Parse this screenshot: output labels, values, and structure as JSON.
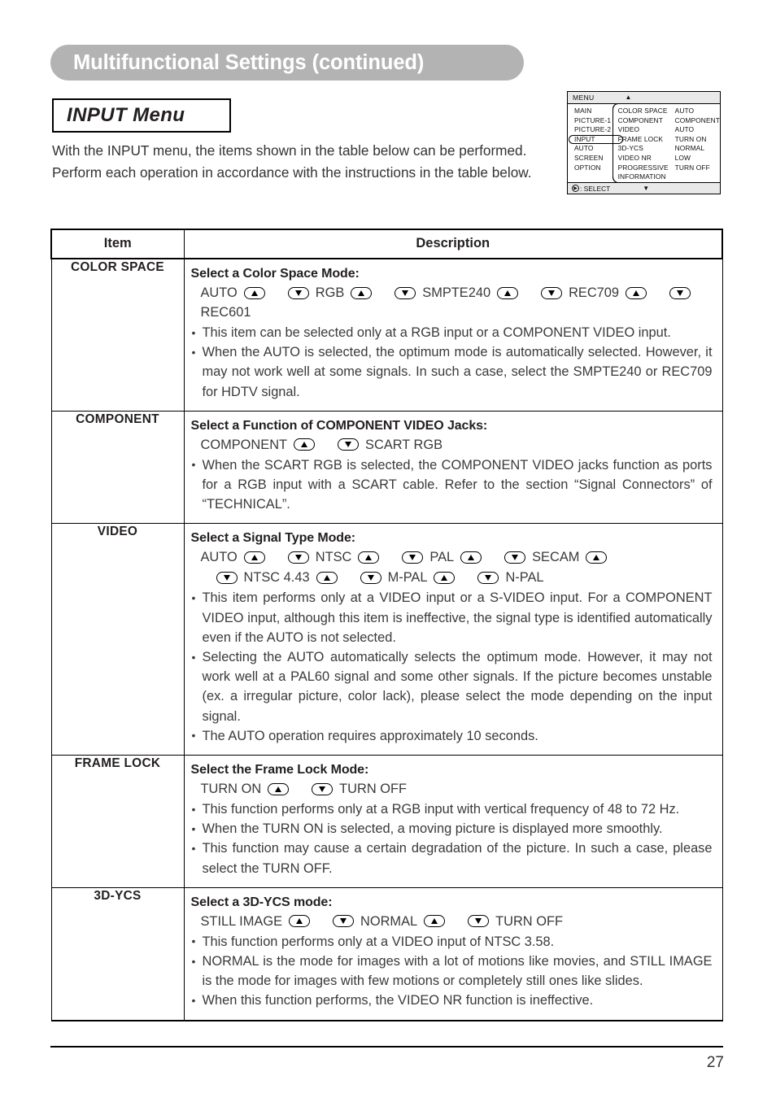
{
  "header": {
    "title": "Multifunctional Settings (continued)",
    "section_title": "INPUT Menu"
  },
  "intro": {
    "line1": "With the INPUT menu, the  items shown in the table below can be performed.",
    "line2": "Perform each operation in accordance with the instructions in the table below."
  },
  "osd": {
    "title": "MENU",
    "up_arrow": "▲",
    "down_arrow": "▼",
    "select_icon": "▶",
    "select_label": ": SELECT",
    "nav_items": [
      {
        "label": "MAIN",
        "selected": false
      },
      {
        "label": "PICTURE-1",
        "selected": false
      },
      {
        "label": "PICTURE-2",
        "selected": false
      },
      {
        "label": "INPUT",
        "selected": true
      },
      {
        "label": "AUTO",
        "selected": false
      },
      {
        "label": "SCREEN",
        "selected": false
      },
      {
        "label": "OPTION",
        "selected": false
      }
    ],
    "settings": [
      {
        "name": "COLOR SPACE",
        "value": "AUTO"
      },
      {
        "name": "COMPONENT",
        "value": "COMPONENT"
      },
      {
        "name": "VIDEO",
        "value": "AUTO"
      },
      {
        "name": "FRAME LOCK",
        "value": "TURN ON"
      },
      {
        "name": "3D-YCS",
        "value": "NORMAL"
      },
      {
        "name": "VIDEO NR",
        "value": "LOW"
      },
      {
        "name": "PROGRESSIVE",
        "value": "TURN OFF"
      },
      {
        "name": "INFORMATION",
        "value": ""
      }
    ]
  },
  "table": {
    "headers": {
      "item": "Item",
      "description": "Description"
    },
    "rows": [
      {
        "item": "COLOR SPACE",
        "title": "Select a Color Space Mode:",
        "options": [
          {
            "text": "AUTO",
            "after": "up"
          },
          {
            "text": "RGB",
            "before": "down",
            "after": "up"
          },
          {
            "text": "SMPTE240",
            "before": "down",
            "after": "up"
          },
          {
            "text": "REC709",
            "before": "down",
            "after": "up"
          },
          {
            "text": "REC601",
            "before": "down"
          }
        ],
        "bullets": [
          "This item can be selected only at a RGB input or a COMPONENT VIDEO input.",
          "When the AUTO is selected, the optimum mode is automatically selected. However, it may not work well at some signals. In such a case, select the SMPTE240 or REC709 for HDTV signal."
        ]
      },
      {
        "item": "COMPONENT",
        "title": "Select a Function of COMPONENT VIDEO Jacks:",
        "options": [
          {
            "text": "COMPONENT",
            "after": "up"
          },
          {
            "text": "SCART RGB",
            "before": "down"
          }
        ],
        "bullets": [
          "When the SCART RGB is selected, the COMPONENT VIDEO jacks function as ports for a RGB input with a SCART cable. Refer to the section “Signal Connectors” of “TECHNICAL”."
        ]
      },
      {
        "item": "VIDEO",
        "title": "Select a Signal Type Mode:",
        "options": [
          {
            "text": "AUTO",
            "after": "up"
          },
          {
            "text": "NTSC",
            "before": "down",
            "after": "up"
          },
          {
            "text": "PAL",
            "before": "down",
            "after": "up"
          },
          {
            "text": "SECAM",
            "before": "down",
            "after": "up"
          }
        ],
        "options2": [
          {
            "text": "NTSC 4.43",
            "before": "down",
            "after": "up"
          },
          {
            "text": "M-PAL",
            "before": "down",
            "after": "up"
          },
          {
            "text": "N-PAL",
            "before": "down"
          }
        ],
        "bullets": [
          "This item performs only at a VIDEO input or a S-VIDEO input. For a COMPONENT VIDEO input, although this item is ineffective, the signal type is identified automatically even if the AUTO is not selected.",
          "Selecting the AUTO automatically selects the optimum mode. However, it may not work well at a PAL60 signal and some other signals. If the picture becomes unstable (ex. a irregular picture, color lack), please select the mode depending on the input signal.",
          "The AUTO operation requires approximately 10 seconds."
        ]
      },
      {
        "item": "FRAME LOCK",
        "title": "Select the Frame Lock Mode:",
        "options": [
          {
            "text": "TURN ON",
            "after": "up"
          },
          {
            "text": "TURN OFF",
            "before": "down"
          }
        ],
        "bullets": [
          "This function performs only at a RGB input with vertical frequency of 48 to 72 Hz.",
          "When the TURN ON is selected, a moving picture is displayed more smoothly.",
          "This function may cause a certain degradation of the picture. In such a case, please select the TURN OFF."
        ]
      },
      {
        "item": "3D-YCS",
        "title": "Select a 3D-YCS mode:",
        "options": [
          {
            "text": "STILL IMAGE",
            "after": "up"
          },
          {
            "text": "NORMAL",
            "before": "down",
            "after": "up"
          },
          {
            "text": "TURN OFF",
            "before": "down"
          }
        ],
        "bullets": [
          "This function performs only at a VIDEO input of NTSC 3.58.",
          "NORMAL is the mode for images with a lot of motions like movies, and STILL IMAGE is the mode for images with few motions or completely still ones like slides.",
          "When this function performs, the VIDEO NR function is ineffective."
        ]
      }
    ]
  },
  "footer": {
    "page_number": "27"
  }
}
